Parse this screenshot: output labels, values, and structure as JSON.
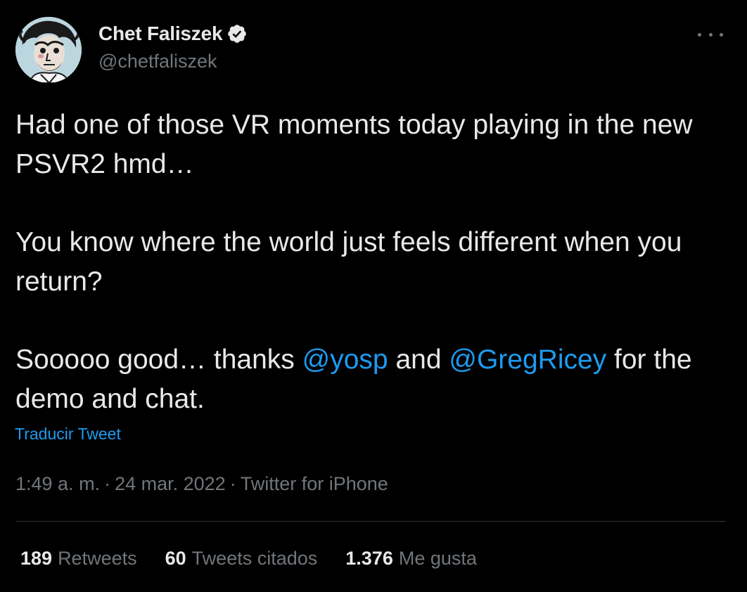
{
  "author": {
    "display_name": "Chet Faliszek",
    "handle": "@chetfaliszek",
    "verified": true,
    "avatar_icon": "avatar-illustration"
  },
  "menu": {
    "icon": "more-horizontal-icon"
  },
  "tweet": {
    "paragraphs": [
      {
        "segments": [
          {
            "text": "Had one of those VR moments today playing in the new PSVR2 hmd…"
          }
        ]
      },
      {
        "segments": [
          {
            "text": "You know where the world just feels different when you return?"
          }
        ]
      },
      {
        "segments": [
          {
            "text": "Sooooo good… thanks "
          },
          {
            "text": "@yosp",
            "mention": true
          },
          {
            "text": " and "
          },
          {
            "text": "@GregRicey",
            "mention": true
          },
          {
            "text": " for the demo and chat."
          }
        ]
      }
    ],
    "translate_label": "Traducir Tweet"
  },
  "meta": {
    "time": "1:49 a. m.",
    "separator": "·",
    "date": "24 mar. 2022",
    "source": "Twitter for iPhone"
  },
  "stats": [
    {
      "count": "189",
      "label": "Retweets"
    },
    {
      "count": "60",
      "label": "Tweets citados"
    },
    {
      "count": "1.376",
      "label": "Me gusta"
    }
  ],
  "colors": {
    "background": "#000000",
    "text": "#e7e9ea",
    "secondary": "#71767b",
    "accent": "#1d9bf0",
    "divider": "#2f3336"
  }
}
